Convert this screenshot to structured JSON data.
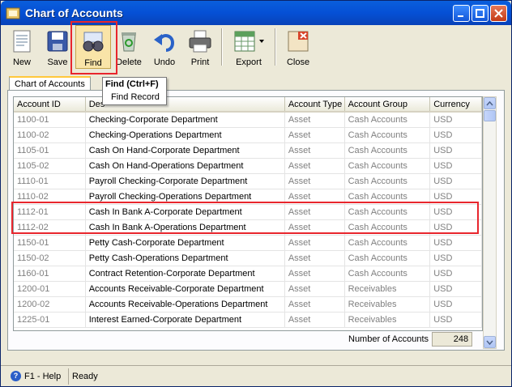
{
  "window": {
    "title": "Chart of Accounts"
  },
  "toolbar": {
    "new": "New",
    "save": "Save",
    "find": "Find",
    "delete": "Delete",
    "undo": "Undo",
    "print": "Print",
    "export": "Export",
    "close": "Close"
  },
  "tooltip": {
    "title": "Find (Ctrl+F)",
    "body": "Find Record"
  },
  "tabs": [
    {
      "label": "Chart of Accounts"
    }
  ],
  "grid": {
    "columns": [
      "Account ID",
      "Description",
      "Account Type",
      "Account Group",
      "Currency"
    ],
    "header_visible_desc": "Des",
    "rows": [
      {
        "id": "1100-01",
        "desc": "Checking-Corporate Department",
        "type": "Asset",
        "group": "Cash Accounts",
        "currency": "USD"
      },
      {
        "id": "1100-02",
        "desc": "Checking-Operations Department",
        "type": "Asset",
        "group": "Cash Accounts",
        "currency": "USD"
      },
      {
        "id": "1105-01",
        "desc": "Cash On Hand-Corporate Department",
        "type": "Asset",
        "group": "Cash Accounts",
        "currency": "USD"
      },
      {
        "id": "1105-02",
        "desc": "Cash On Hand-Operations Department",
        "type": "Asset",
        "group": "Cash Accounts",
        "currency": "USD"
      },
      {
        "id": "1110-01",
        "desc": "Payroll Checking-Corporate Department",
        "type": "Asset",
        "group": "Cash Accounts",
        "currency": "USD"
      },
      {
        "id": "1110-02",
        "desc": "Payroll Checking-Operations Department",
        "type": "Asset",
        "group": "Cash Accounts",
        "currency": "USD"
      },
      {
        "id": "1112-01",
        "desc": "Cash In Bank A-Corporate Department",
        "type": "Asset",
        "group": "Cash Accounts",
        "currency": "USD"
      },
      {
        "id": "1112-02",
        "desc": "Cash In Bank A-Operations Department",
        "type": "Asset",
        "group": "Cash Accounts",
        "currency": "USD"
      },
      {
        "id": "1150-01",
        "desc": "Petty Cash-Corporate Department",
        "type": "Asset",
        "group": "Cash Accounts",
        "currency": "USD"
      },
      {
        "id": "1150-02",
        "desc": "Petty Cash-Operations Department",
        "type": "Asset",
        "group": "Cash Accounts",
        "currency": "USD"
      },
      {
        "id": "1160-01",
        "desc": "Contract Retention-Corporate Department",
        "type": "Asset",
        "group": "Cash Accounts",
        "currency": "USD"
      },
      {
        "id": "1200-01",
        "desc": "Accounts Receivable-Corporate Department",
        "type": "Asset",
        "group": "Receivables",
        "currency": "USD"
      },
      {
        "id": "1200-02",
        "desc": "Accounts Receivable-Operations Department",
        "type": "Asset",
        "group": "Receivables",
        "currency": "USD"
      },
      {
        "id": "1225-01",
        "desc": "Interest Earned-Corporate Department",
        "type": "Asset",
        "group": "Receivables",
        "currency": "USD"
      }
    ]
  },
  "footer": {
    "count_label": "Number of Accounts",
    "count_value": "248"
  },
  "statusbar": {
    "help": "F1 - Help",
    "status": "Ready"
  }
}
